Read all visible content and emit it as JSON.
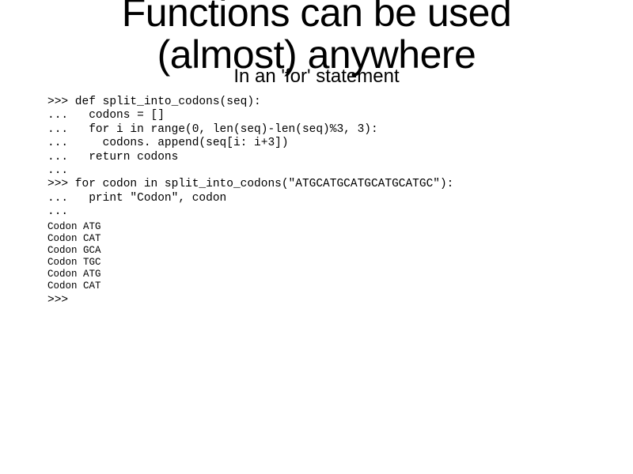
{
  "title": "Functions can be used (almost) anywhere",
  "subtitle": "In an 'for' statement",
  "code": ">>> def split_into_codons(seq):\n...   codons = []\n...   for i in range(0, len(seq)-len(seq)%3, 3):\n...     codons. append(seq[i: i+3])\n...   return codons\n...\n>>> for codon in split_into_codons(\"ATGCATGCATGCATGCATGC\"):\n...   print \"Codon\", codon\n...",
  "output": "Codon ATG\nCodon CAT\nCodon GCA\nCodon TGC\nCodon ATG\nCodon CAT",
  "final_prompt": ">>>"
}
